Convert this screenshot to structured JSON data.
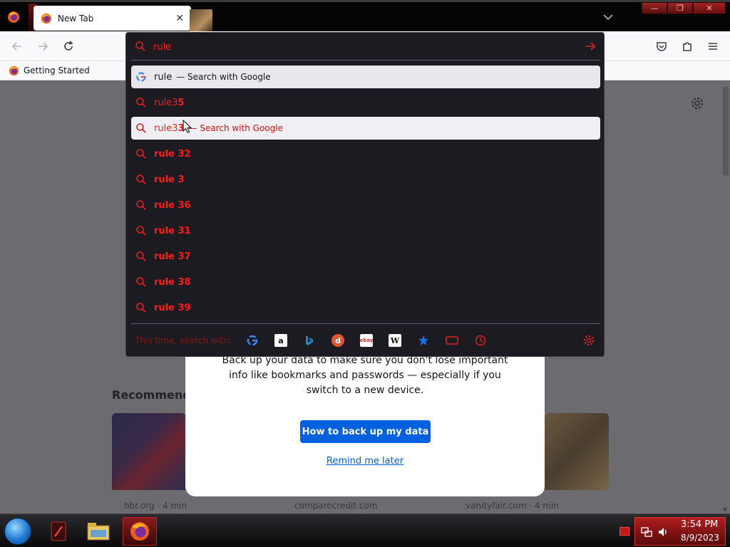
{
  "browser": {
    "tab": {
      "title": "New Tab"
    },
    "bookmarks": [
      {
        "label": "Getting Started"
      }
    ]
  },
  "urlbar": {
    "value": "rule",
    "suggestions": [
      {
        "text": "rule",
        "typed": "rule",
        "rest": "",
        "action": "— Search with Google",
        "icon": "google-icon",
        "state": "selected"
      },
      {
        "text": "rule35",
        "typed": "rule3",
        "rest": "5",
        "action": "",
        "icon": "search-icon",
        "state": ""
      },
      {
        "text": "rule33",
        "typed": "rule3",
        "rest": "3",
        "action": "— Search with Google",
        "icon": "search-icon",
        "state": "hover"
      },
      {
        "text": "rule 32",
        "typed": "",
        "rest": "rule 32",
        "action": "",
        "icon": "search-icon",
        "state": ""
      },
      {
        "text": "rule 3",
        "typed": "",
        "rest": "rule 3",
        "action": "",
        "icon": "search-icon",
        "state": ""
      },
      {
        "text": "rule 36",
        "typed": "",
        "rest": "rule 36",
        "action": "",
        "icon": "search-icon",
        "state": ""
      },
      {
        "text": "rule 31",
        "typed": "",
        "rest": "rule 31",
        "action": "",
        "icon": "search-icon",
        "state": ""
      },
      {
        "text": "rule 37",
        "typed": "",
        "rest": "rule 37",
        "action": "",
        "icon": "search-icon",
        "state": ""
      },
      {
        "text": "rule 38",
        "typed": "",
        "rest": "rule 38",
        "action": "",
        "icon": "search-icon",
        "state": ""
      },
      {
        "text": "rule 39",
        "typed": "",
        "rest": "rule 39",
        "action": "",
        "icon": "search-icon",
        "state": ""
      }
    ],
    "oneoff": {
      "label": "This time, search with:",
      "engines": [
        "google-icon",
        "amazon-icon",
        "bing-icon",
        "duckduckgo-icon",
        "ebay-icon",
        "wikipedia-icon",
        "bookmarks-icon",
        "tabs-icon",
        "history-icon"
      ]
    }
  },
  "page": {
    "recommended_title": "Recommended",
    "cards": [
      {
        "source": "hbr.org · 4 min"
      },
      {
        "source": "comparecredit.com"
      },
      {
        "source": "vanityfair.com · 4 min"
      }
    ]
  },
  "modal": {
    "text": "Back up your data to make sure you don't lose important info like bookmarks and passwords — especially if you switch to a new device.",
    "primary_button": "How to back up my data",
    "link": "Remind me later"
  },
  "taskbar": {
    "time": "3:54 PM",
    "date": "8/9/2023"
  },
  "colors": {
    "accent_red": "#ff1a1a",
    "firefox_blue": "#0061e0",
    "dropdown_bg": "#1c1b22"
  }
}
